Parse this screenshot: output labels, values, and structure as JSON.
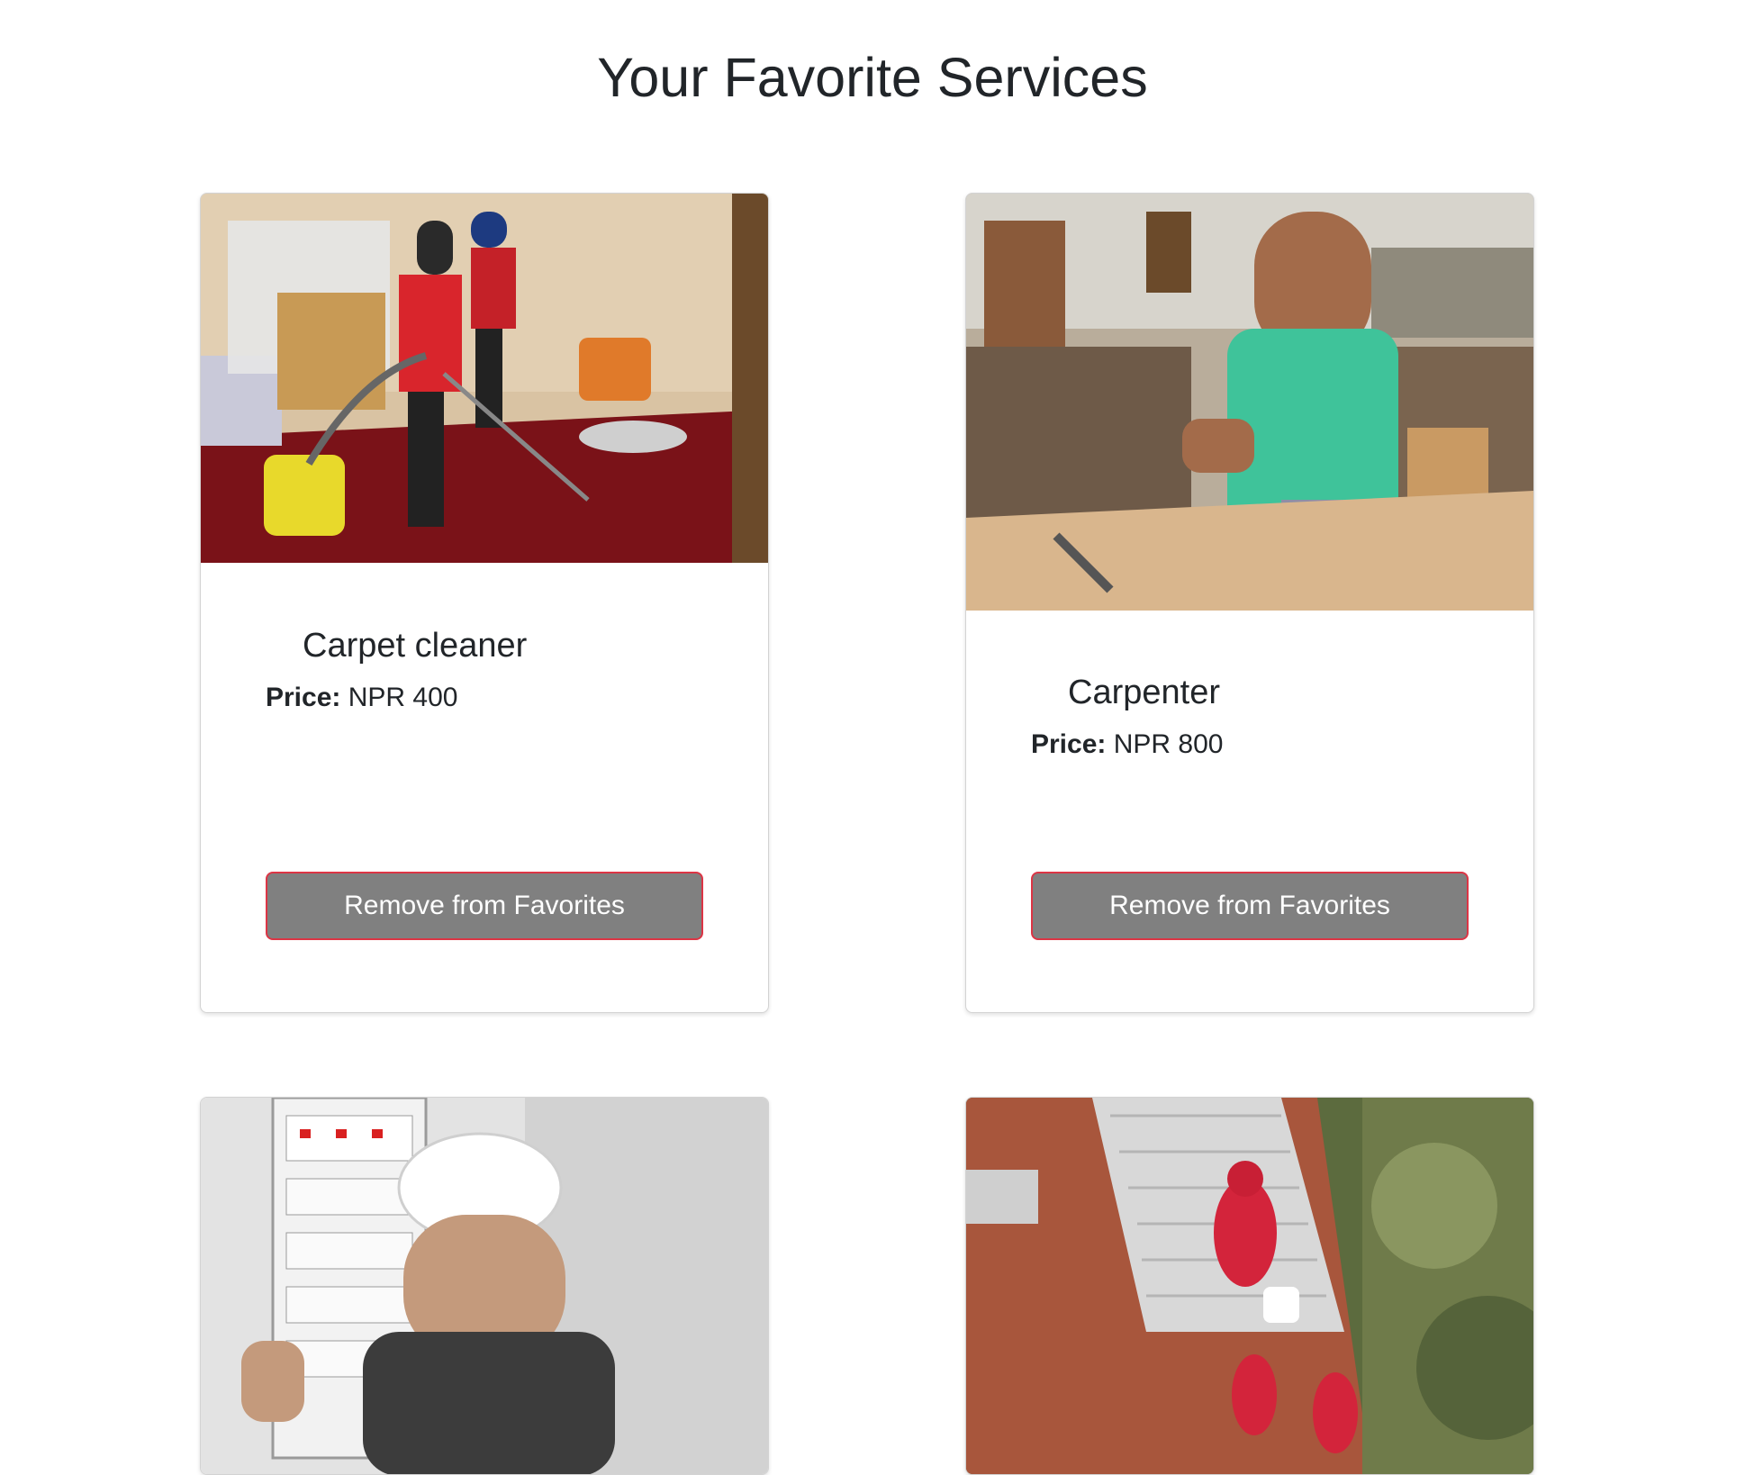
{
  "page": {
    "title": "Your Favorite Services"
  },
  "services": [
    {
      "name": "Carpet cleaner",
      "price_label": "Price:",
      "price_value": "NPR 400",
      "remove_label": "Remove from Favorites",
      "image_subject": "carpet-cleaning-photo"
    },
    {
      "name": "Carpenter",
      "price_label": "Price:",
      "price_value": "NPR 800",
      "remove_label": "Remove from Favorites",
      "image_subject": "carpenter-photo"
    },
    {
      "image_subject": "electrician-photo"
    },
    {
      "image_subject": "building-cleaning-photo"
    }
  ],
  "colors": {
    "button_bg": "#808080",
    "button_border": "#dc3545",
    "button_text": "#ffffff",
    "text": "#212529"
  }
}
